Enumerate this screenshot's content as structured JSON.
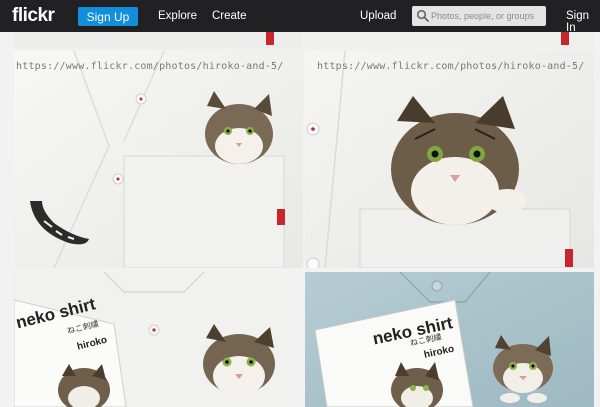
{
  "header": {
    "logo": "flickr",
    "signup_label": "Sign Up",
    "nav_explore": "Explore",
    "nav_create": "Create",
    "nav_upload": "Upload",
    "search_placeholder": "Photos, people, or groups",
    "signin_label": "Sign In"
  },
  "photos": [
    {
      "watermark": "https://www.flickr.com/photos/hiroko-and-5/"
    },
    {
      "watermark": "https://www.flickr.com/photos/hiroko-and-5/"
    },
    {
      "book_title": "neko shirt",
      "book_subtitle": "ねこ刺繍",
      "book_author": "hiroko"
    },
    {
      "book_title": "neko shirt",
      "book_subtitle": "ねこ刺繍",
      "book_author": "hiroko"
    }
  ],
  "colors": {
    "topbar": "#212124",
    "signup_blue": "#128fdc",
    "shirt_white": "#f4f4f2",
    "denim_blue": "#a9c3cc",
    "tag_red": "#c8252c"
  },
  "icons": [
    "search-icon"
  ]
}
